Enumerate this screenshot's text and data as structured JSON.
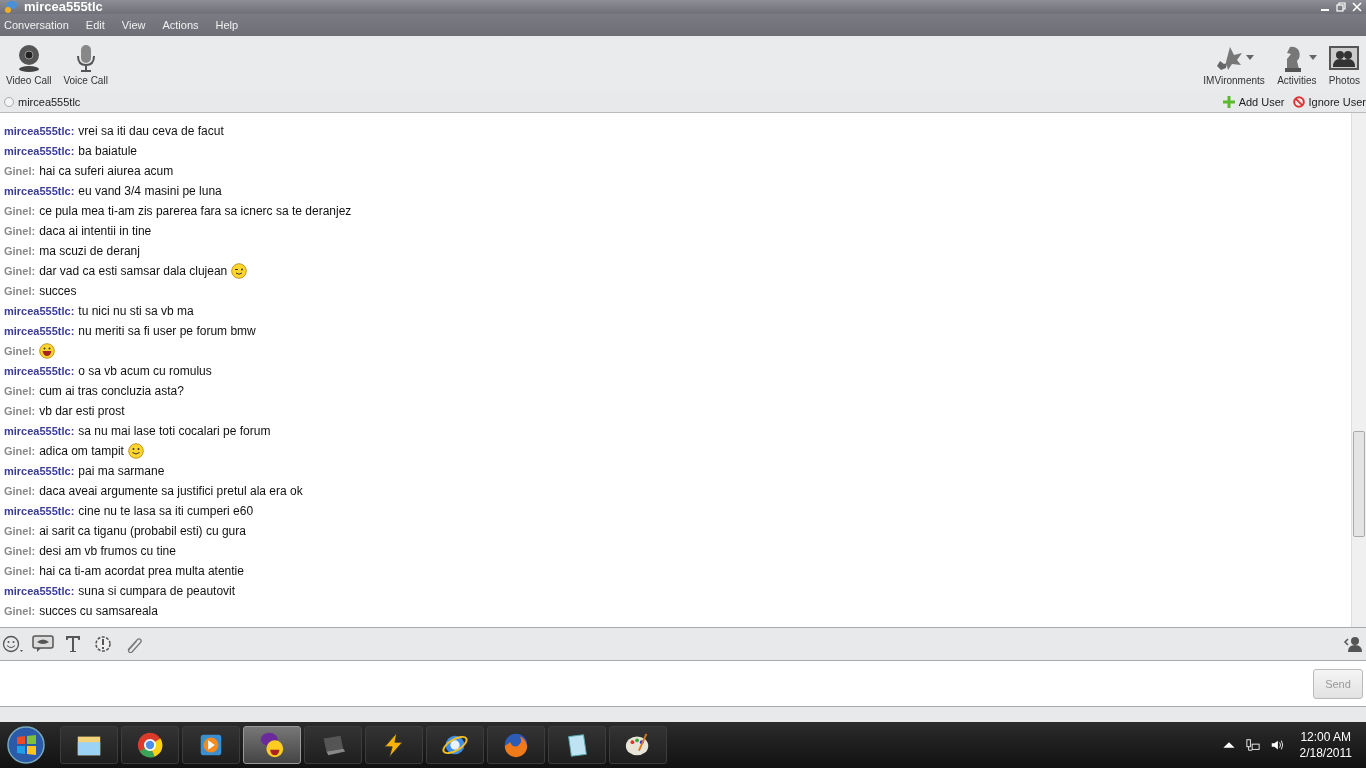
{
  "window": {
    "title": "mircea555tlc"
  },
  "menu": [
    "Conversation",
    "Edit",
    "View",
    "Actions",
    "Help"
  ],
  "toolbar_left": [
    {
      "kind": "webcam",
      "label": "Video Call"
    },
    {
      "kind": "mic",
      "label": "Voice Call"
    }
  ],
  "toolbar_right": [
    {
      "kind": "leaves",
      "label": "IMVironments",
      "dropdown": true
    },
    {
      "kind": "knight",
      "label": "Activities",
      "dropdown": true
    },
    {
      "kind": "photos",
      "label": "Photos",
      "dropdown": false
    }
  ],
  "contact": {
    "name": "mircea555tlc",
    "online": false
  },
  "actions": [
    {
      "kind": "add",
      "label": "Add User"
    },
    {
      "kind": "ignore",
      "label": "Ignore User"
    }
  ],
  "messages": [
    {
      "kind": "plain",
      "sender": "mircea555tlc:",
      "color": "#3b3b9a",
      "text": "vrei sa iti dau ceva de facut"
    },
    {
      "kind": "plain",
      "sender": "mircea555tlc:",
      "color": "#3b3b9a",
      "text": "ba baiatule"
    },
    {
      "kind": "plain",
      "sender": "Ginel:",
      "color": "#8a8a8a",
      "text": "hai ca suferi aiurea acum"
    },
    {
      "kind": "plain",
      "sender": "mircea555tlc:",
      "color": "#3b3b9a",
      "text": "eu vand 3/4 masini pe luna"
    },
    {
      "kind": "plain",
      "sender": "Ginel:",
      "color": "#8a8a8a",
      "text": "ce pula mea ti-am zis parerea fara sa icnerc sa te deranjez"
    },
    {
      "kind": "plain",
      "sender": "Ginel:",
      "color": "#8a8a8a",
      "text": "daca ai intentii in tine"
    },
    {
      "kind": "plain",
      "sender": "Ginel:",
      "color": "#8a8a8a",
      "text": "ma scuzi de deranj"
    },
    {
      "kind": "wink",
      "sender": "Ginel:",
      "color": "#8a8a8a",
      "text": "dar vad ca esti samsar dala clujean"
    },
    {
      "kind": "plain",
      "sender": "Ginel:",
      "color": "#8a8a8a",
      "text": "succes"
    },
    {
      "kind": "plain",
      "sender": "mircea555tlc:",
      "color": "#3b3b9a",
      "text": "tu nici nu sti sa vb ma"
    },
    {
      "kind": "plain",
      "sender": "mircea555tlc:",
      "color": "#3b3b9a",
      "text": "nu meriti sa fi user pe forum bmw"
    },
    {
      "kind": "grin",
      "sender": "Ginel:",
      "color": "#8a8a8a"
    },
    {
      "kind": "plain",
      "sender": "mircea555tlc:",
      "color": "#3b3b9a",
      "text": "o sa vb acum cu romulus"
    },
    {
      "kind": "plain",
      "sender": "Ginel:",
      "color": "#8a8a8a",
      "text": "cum ai tras concluzia asta?"
    },
    {
      "kind": "plain",
      "sender": "Ginel:",
      "color": "#8a8a8a",
      "text": "vb dar esti prost"
    },
    {
      "kind": "plain",
      "sender": "mircea555tlc:",
      "color": "#3b3b9a",
      "text": "sa nu mai lase toti cocalari pe forum"
    },
    {
      "kind": "smile",
      "sender": "Ginel:",
      "color": "#8a8a8a",
      "text": "adica om tampit"
    },
    {
      "kind": "plain",
      "sender": "mircea555tlc:",
      "color": "#3b3b9a",
      "text": "pai ma sarmane"
    },
    {
      "kind": "plain",
      "sender": "Ginel:",
      "color": "#8a8a8a",
      "text": "daca aveai argumente sa justifici pretul ala era ok"
    },
    {
      "kind": "plain",
      "sender": "mircea555tlc:",
      "color": "#3b3b9a",
      "text": "cine nu te lasa sa iti cumperi e60"
    },
    {
      "kind": "plain",
      "sender": "Ginel:",
      "color": "#8a8a8a",
      "text": "ai sarit ca tiganu (probabil esti) cu gura"
    },
    {
      "kind": "plain",
      "sender": "Ginel:",
      "color": "#8a8a8a",
      "text": "desi am vb frumos cu tine"
    },
    {
      "kind": "plain",
      "sender": "Ginel:",
      "color": "#8a8a8a",
      "text": "hai ca ti-am acordat prea multa atentie"
    },
    {
      "kind": "plain",
      "sender": "mircea555tlc:",
      "color": "#3b3b9a",
      "text": "suna si cumpara de peautovit"
    },
    {
      "kind": "plain",
      "sender": "Ginel:",
      "color": "#8a8a8a",
      "text": "succes cu samsareala"
    }
  ],
  "compose": {
    "send": "Send",
    "send_disabled": true
  },
  "taskbar": {
    "apps": [
      {
        "kind": "folder",
        "selected": false
      },
      {
        "kind": "chrome",
        "selected": false
      },
      {
        "kind": "player",
        "selected": false
      },
      {
        "kind": "yahoo",
        "selected": true
      },
      {
        "kind": "laptop",
        "selected": false
      },
      {
        "kind": "bolt",
        "selected": false
      },
      {
        "kind": "ie",
        "selected": false
      },
      {
        "kind": "firefox",
        "selected": false
      },
      {
        "kind": "notepad",
        "selected": false
      },
      {
        "kind": "paint",
        "selected": false
      }
    ],
    "time": "12:00 AM",
    "date": "2/18/2011"
  }
}
